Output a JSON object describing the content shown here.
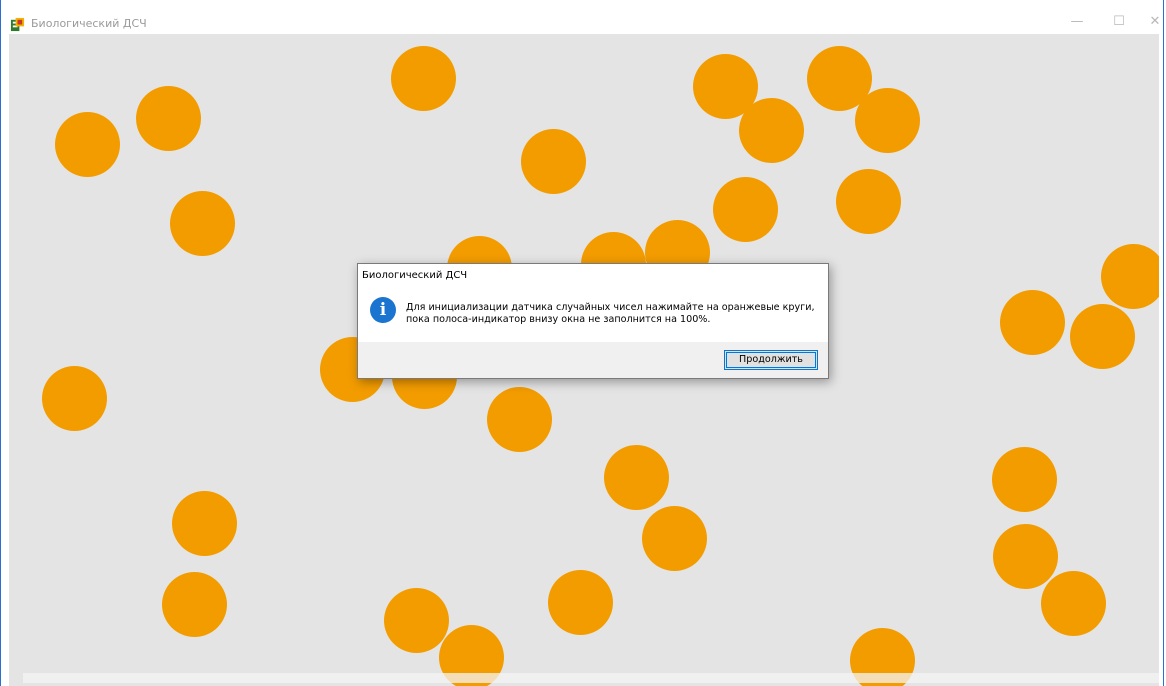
{
  "window": {
    "title": "Биологический ДСЧ",
    "minimize_glyph": "—",
    "maximize_glyph": "☐",
    "close_glyph": "✕"
  },
  "colors": {
    "circle": "#f39c00",
    "canvas": "#e4e4e4",
    "accent": "#0078d7",
    "info_icon": "#1b75d0"
  },
  "progress": {
    "fraction": 0
  },
  "dialog": {
    "title": "Биологический ДСЧ",
    "icon": "info-icon",
    "icon_glyph": "i",
    "message_line1": "Для инициализации датчика случайных чисел нажимайте на оранжевые круги,",
    "message_line2": "пока полоса-индикатор внизу окна не заполнится на 100%.",
    "button_label": "Продолжить"
  }
}
